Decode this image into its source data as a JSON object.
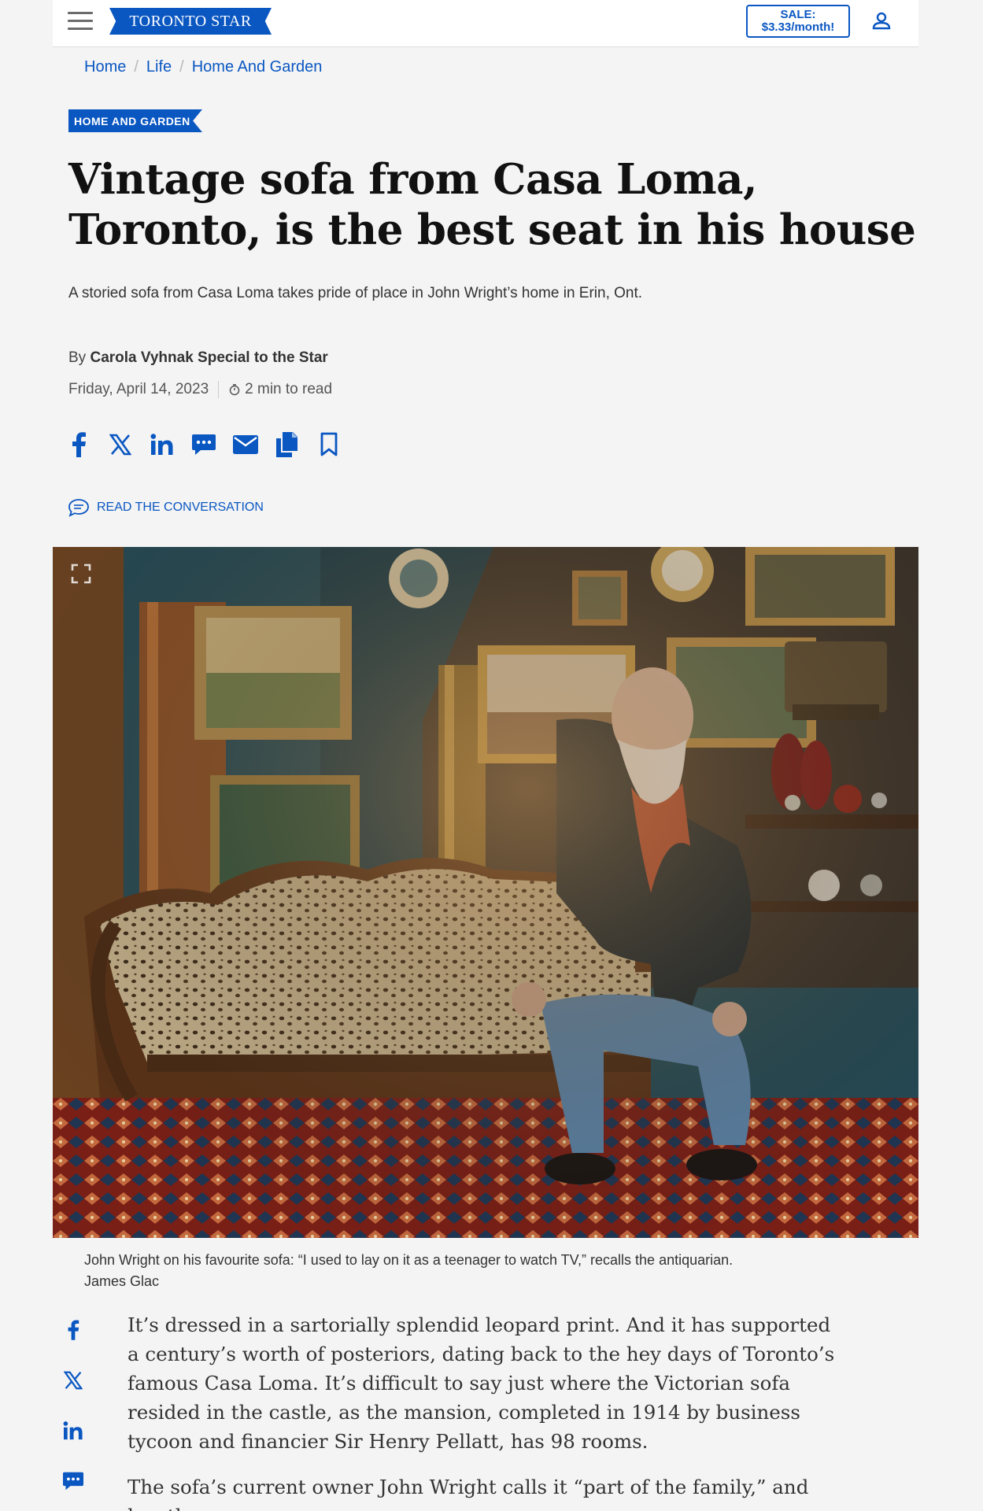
{
  "header": {
    "logo_text": "TORONTO STAR",
    "sale_line1": "SALE:",
    "sale_line2": "$3.33/month!",
    "brand_color": "#0a57c2"
  },
  "breadcrumb": [
    "Home",
    "Life",
    "Home And Garden"
  ],
  "section_tag": "HOME AND GARDEN",
  "article": {
    "headline": "Vintage sofa from Casa Loma, Toronto, is the best seat in his house",
    "dek": "A storied sofa from Casa Loma takes pride of place in John Wright’s home in Erin, Ont.",
    "byline_prefix": "By",
    "byline_author": "Carola Vyhnak Special to the Star",
    "date": "Friday, April 14, 2023",
    "read_time": "2 min to read",
    "conversation_label": "READ THE CONVERSATION",
    "caption_text": "John Wright on his favourite sofa: “I used to lay on it as a teenager to watch TV,” recalls the antiquarian.",
    "caption_credit": "James Glac",
    "paragraph_1": "It’s dressed in a sartorially splendid leopard print. And it has supported a century’s worth of posteriors, dating back to the hey days of Toronto’s famous Casa Loma. It’s difficult to say just where the Victorian sofa resided in the castle, as the mansion, completed in 1914 by business tycoon and financier Sir Henry Pellatt, has 98 rooms.",
    "paragraph_2": "The sofa’s current owner John Wright calls it “part of the family,” and has the"
  },
  "share_icons": [
    "facebook-icon",
    "x-icon",
    "linkedin-icon",
    "comment-icon",
    "email-icon",
    "copy-icon",
    "bookmark-icon"
  ],
  "side_share_icons": [
    "facebook-icon",
    "x-icon",
    "linkedin-icon",
    "comment-icon"
  ]
}
